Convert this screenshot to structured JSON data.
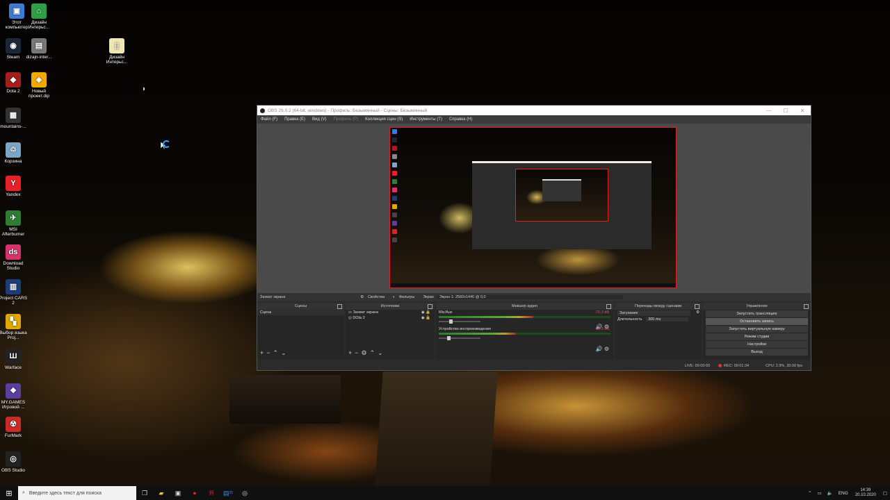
{
  "desktop": {
    "icons": [
      {
        "label": "Этот компьютер",
        "icon": "computer-icon",
        "color": "#3a7bd5",
        "glyph": "▣"
      },
      {
        "label": "Дизайн Интерьс...",
        "icon": "interior-design-icon",
        "color": "#2f9e44",
        "glyph": "⌂"
      },
      {
        "label": "Steam",
        "icon": "steam-icon",
        "color": "#1b2838",
        "glyph": "◉"
      },
      {
        "label": "dizajn-inter...",
        "icon": "image-file-icon",
        "color": "#777777",
        "glyph": "▤"
      },
      {
        "label": "Дизайн Интерьс...",
        "icon": "folder-file-icon",
        "color": "#f0e6b0",
        "glyph": "▯"
      },
      {
        "label": "Dota 2",
        "icon": "dota2-icon",
        "color": "#a51e1e",
        "glyph": "◆"
      },
      {
        "label": "Новый проект.dip",
        "icon": "project-file-icon",
        "color": "#f2a900",
        "glyph": "◈"
      },
      {
        "label": "mountains-...",
        "icon": "image-file-icon",
        "color": "#333333",
        "glyph": "▦"
      },
      {
        "label": "Корзина",
        "icon": "recycle-bin-icon",
        "color": "#7aa7c7",
        "glyph": "♲"
      },
      {
        "label": "Yandex",
        "icon": "yandex-browser-icon",
        "color": "#e8202a",
        "glyph": "Y"
      },
      {
        "label": "MSI Afterburner",
        "icon": "msi-afterburner-icon",
        "color": "#2e7d32",
        "glyph": "✈"
      },
      {
        "label": "Download Studio",
        "icon": "download-studio-icon",
        "color": "#d6336c",
        "glyph": "ds"
      },
      {
        "label": "Project CARS 2",
        "icon": "project-cars-icon",
        "color": "#1c3d7a",
        "glyph": "▥"
      },
      {
        "label": "Выбор языка Proj...",
        "icon": "language-select-icon",
        "color": "#e0a800",
        "glyph": "▚"
      },
      {
        "label": "Warface",
        "icon": "warface-icon",
        "color": "#222222",
        "glyph": "Ш"
      },
      {
        "label": "MY.GAMES Игровой ...",
        "icon": "mygames-icon",
        "color": "#5a3fa0",
        "glyph": "❖"
      },
      {
        "label": "FurMark",
        "icon": "furmark-icon",
        "color": "#c92a2a",
        "glyph": "☢"
      },
      {
        "label": "OBS Studio",
        "icon": "obs-studio-icon",
        "color": "#222222",
        "glyph": "◎"
      }
    ]
  },
  "obs": {
    "title": "OBS 26.0.2 (64-bit, windows) - Профиль: Безымянный - Сцены: Безымянный",
    "menu": [
      "Файл (F)",
      "Правка (E)",
      "Вид (V)",
      "Профиль (P)",
      "Коллекция сцен (S)",
      "Инструменты (T)",
      "Справка (H)"
    ],
    "source_bar": {
      "source": "Захват экрана",
      "properties": "Свойства",
      "filters": "Фильтры",
      "screen_label": "Экран",
      "screen_value": "Экран 1: 2560x1440 @ 0,0"
    },
    "docks": {
      "scenes": {
        "title": "Сцены",
        "items": [
          "Сцена"
        ]
      },
      "sources": {
        "title": "Источники",
        "items": [
          "Захват экрана",
          "DOta 2"
        ]
      },
      "mixer": {
        "title": "Микшер аудио",
        "channels": [
          {
            "name": "Mic/Aux",
            "db": "-70.3 dB",
            "level": 0.55
          },
          {
            "name": "Устройство воспроизведения",
            "db": "-70.9 dB",
            "level": 0.45
          }
        ]
      },
      "transitions": {
        "title": "Переходы между сценами",
        "type": "Затухание",
        "duration_label": "Длительность",
        "duration": "300 ms"
      },
      "controls": {
        "title": "Управление",
        "buttons": [
          "Запустить трансляцию",
          "Остановить запись",
          "Запустить виртуальную камеру",
          "Режим студии",
          "Настройки",
          "Выход"
        ]
      }
    },
    "status": {
      "live": "LIVE: 00:00:00",
      "rec": "REC: 00:01:34",
      "cpu": "CPU: 2.9%, 30.00 fps"
    }
  },
  "taskbar": {
    "search_placeholder": "Введите здесь текст для поиска",
    "lang": "ENG",
    "time": "14:39",
    "date": "20.10.2020",
    "badge": "25"
  }
}
